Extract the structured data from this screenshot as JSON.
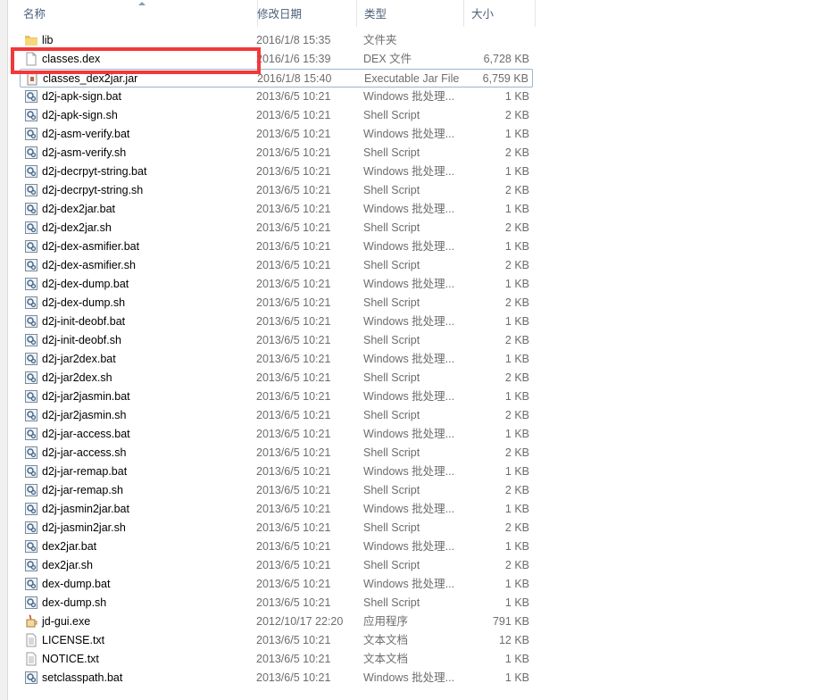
{
  "columns": {
    "name": "名称",
    "date": "修改日期",
    "type": "类型",
    "size": "大小"
  },
  "highlight_color": "#f2383a",
  "files": [
    {
      "name": "lib",
      "date": "2016/1/8 15:35",
      "type": "文件夹",
      "size": "",
      "icon": "folder"
    },
    {
      "name": "classes.dex",
      "date": "2016/1/6 15:39",
      "type": "DEX 文件",
      "size": "6,728 KB",
      "icon": "file",
      "highlighted": true
    },
    {
      "name": "classes_dex2jar.jar",
      "date": "2016/1/8 15:40",
      "type": "Executable Jar File",
      "size": "6,759 KB",
      "icon": "jar",
      "focused": true
    },
    {
      "name": "d2j-apk-sign.bat",
      "date": "2013/6/5 10:21",
      "type": "Windows 批处理...",
      "size": "1 KB",
      "icon": "script"
    },
    {
      "name": "d2j-apk-sign.sh",
      "date": "2013/6/5 10:21",
      "type": "Shell Script",
      "size": "2 KB",
      "icon": "script"
    },
    {
      "name": "d2j-asm-verify.bat",
      "date": "2013/6/5 10:21",
      "type": "Windows 批处理...",
      "size": "1 KB",
      "icon": "script"
    },
    {
      "name": "d2j-asm-verify.sh",
      "date": "2013/6/5 10:21",
      "type": "Shell Script",
      "size": "2 KB",
      "icon": "script"
    },
    {
      "name": "d2j-decrpyt-string.bat",
      "date": "2013/6/5 10:21",
      "type": "Windows 批处理...",
      "size": "1 KB",
      "icon": "script"
    },
    {
      "name": "d2j-decrpyt-string.sh",
      "date": "2013/6/5 10:21",
      "type": "Shell Script",
      "size": "2 KB",
      "icon": "script"
    },
    {
      "name": "d2j-dex2jar.bat",
      "date": "2013/6/5 10:21",
      "type": "Windows 批处理...",
      "size": "1 KB",
      "icon": "script"
    },
    {
      "name": "d2j-dex2jar.sh",
      "date": "2013/6/5 10:21",
      "type": "Shell Script",
      "size": "2 KB",
      "icon": "script"
    },
    {
      "name": "d2j-dex-asmifier.bat",
      "date": "2013/6/5 10:21",
      "type": "Windows 批处理...",
      "size": "1 KB",
      "icon": "script"
    },
    {
      "name": "d2j-dex-asmifier.sh",
      "date": "2013/6/5 10:21",
      "type": "Shell Script",
      "size": "2 KB",
      "icon": "script"
    },
    {
      "name": "d2j-dex-dump.bat",
      "date": "2013/6/5 10:21",
      "type": "Windows 批处理...",
      "size": "1 KB",
      "icon": "script"
    },
    {
      "name": "d2j-dex-dump.sh",
      "date": "2013/6/5 10:21",
      "type": "Shell Script",
      "size": "2 KB",
      "icon": "script"
    },
    {
      "name": "d2j-init-deobf.bat",
      "date": "2013/6/5 10:21",
      "type": "Windows 批处理...",
      "size": "1 KB",
      "icon": "script"
    },
    {
      "name": "d2j-init-deobf.sh",
      "date": "2013/6/5 10:21",
      "type": "Shell Script",
      "size": "2 KB",
      "icon": "script"
    },
    {
      "name": "d2j-jar2dex.bat",
      "date": "2013/6/5 10:21",
      "type": "Windows 批处理...",
      "size": "1 KB",
      "icon": "script"
    },
    {
      "name": "d2j-jar2dex.sh",
      "date": "2013/6/5 10:21",
      "type": "Shell Script",
      "size": "2 KB",
      "icon": "script"
    },
    {
      "name": "d2j-jar2jasmin.bat",
      "date": "2013/6/5 10:21",
      "type": "Windows 批处理...",
      "size": "1 KB",
      "icon": "script"
    },
    {
      "name": "d2j-jar2jasmin.sh",
      "date": "2013/6/5 10:21",
      "type": "Shell Script",
      "size": "2 KB",
      "icon": "script"
    },
    {
      "name": "d2j-jar-access.bat",
      "date": "2013/6/5 10:21",
      "type": "Windows 批处理...",
      "size": "1 KB",
      "icon": "script"
    },
    {
      "name": "d2j-jar-access.sh",
      "date": "2013/6/5 10:21",
      "type": "Shell Script",
      "size": "2 KB",
      "icon": "script"
    },
    {
      "name": "d2j-jar-remap.bat",
      "date": "2013/6/5 10:21",
      "type": "Windows 批处理...",
      "size": "1 KB",
      "icon": "script"
    },
    {
      "name": "d2j-jar-remap.sh",
      "date": "2013/6/5 10:21",
      "type": "Shell Script",
      "size": "2 KB",
      "icon": "script"
    },
    {
      "name": "d2j-jasmin2jar.bat",
      "date": "2013/6/5 10:21",
      "type": "Windows 批处理...",
      "size": "1 KB",
      "icon": "script"
    },
    {
      "name": "d2j-jasmin2jar.sh",
      "date": "2013/6/5 10:21",
      "type": "Shell Script",
      "size": "2 KB",
      "icon": "script"
    },
    {
      "name": "dex2jar.bat",
      "date": "2013/6/5 10:21",
      "type": "Windows 批处理...",
      "size": "1 KB",
      "icon": "script"
    },
    {
      "name": "dex2jar.sh",
      "date": "2013/6/5 10:21",
      "type": "Shell Script",
      "size": "2 KB",
      "icon": "script"
    },
    {
      "name": "dex-dump.bat",
      "date": "2013/6/5 10:21",
      "type": "Windows 批处理...",
      "size": "1 KB",
      "icon": "script"
    },
    {
      "name": "dex-dump.sh",
      "date": "2013/6/5 10:21",
      "type": "Shell Script",
      "size": "1 KB",
      "icon": "script"
    },
    {
      "name": "jd-gui.exe",
      "date": "2012/10/17 22:20",
      "type": "应用程序",
      "size": "791 KB",
      "icon": "exe"
    },
    {
      "name": "LICENSE.txt",
      "date": "2013/6/5 10:21",
      "type": "文本文档",
      "size": "12 KB",
      "icon": "text"
    },
    {
      "name": "NOTICE.txt",
      "date": "2013/6/5 10:21",
      "type": "文本文档",
      "size": "1 KB",
      "icon": "text"
    },
    {
      "name": "setclasspath.bat",
      "date": "2013/6/5 10:21",
      "type": "Windows 批处理...",
      "size": "1 KB",
      "icon": "script"
    }
  ]
}
